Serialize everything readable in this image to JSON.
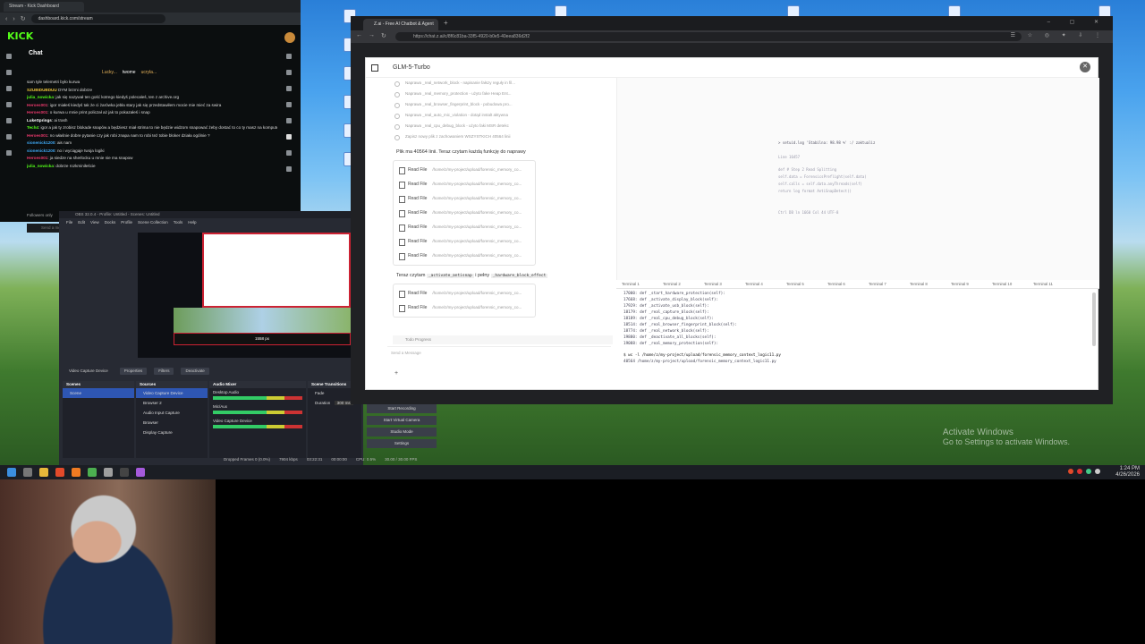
{
  "taskbar": {
    "time": "1:24 PM",
    "date": "4/26/2026"
  },
  "watermark": {
    "line1": "Activate Windows",
    "line2": "Go to Settings to activate Windows."
  },
  "kick": {
    "tab_title": "Stream - Kick Dashboard",
    "url": "dashboard.kick.com/stream",
    "logo": "KICK",
    "chat_title": "Chat",
    "pinned": [
      "Lucky...",
      "twome",
      "ucryla..."
    ],
    "messages": [
      {
        "user": "",
        "text": "sam tyle telemetri było kurwa",
        "color": "#ffffff"
      },
      {
        "user": "SZUBIDUBDUU",
        "text": " DYM brzmi dobrze",
        "color": "#e8c13a"
      },
      {
        "user": "julia_nowicka",
        "text": ": jak się nazywał ten gość kotrego kiedyś polecałeś, ten z archive.org",
        "color": "#53fc18"
      },
      {
        "user": "Heroes001",
        "text": ": igor miałeś kiedyś tak że ci żarówka jebła stary jak się przedstawiłem mocie mie mieć za swira",
        "color": "#e5386a"
      },
      {
        "user": "Heroes001",
        "text": ": o kurwa u mnie print policzał aż jak to pokazałeś i snap",
        "color": "#e5386a"
      },
      {
        "user": "LukeSprings",
        "text": ": ai trash",
        "color": "#ffffff"
      },
      {
        "user": "Tech4",
        "text": ": igor a jak ty zrobisz blokade snapów a będziesz miał strima to nie będzie widzom snapować żeby dostać to co ty masz na komputerze",
        "color": "#53fc18"
      },
      {
        "user": "Heroes001",
        "text": ": no właśnie dobre pytanie czy jak robi znapa nam to robi też tobie bloker działa ogólnie ?",
        "color": "#e5386a"
      },
      {
        "user": "sionenick1200",
        "text": ": ais nam",
        "color": "#3fa9f5"
      },
      {
        "user": "sionenick1200",
        "text": ": no i wyciągaje twoja logiki",
        "color": "#3fa9f5"
      },
      {
        "user": "Heroes001",
        "text": ": ja siedze na sherlocku u mnie nie ma snapow",
        "color": "#e5386a"
      },
      {
        "user": "julia_nowicka",
        "text": ": dobrze rozkminiłeście",
        "color": "#53fc18"
      }
    ],
    "followers_only": "Followers only",
    "send_placeholder": "Send a message"
  },
  "obs": {
    "title": "OBS 32.0.4 - Profile: Untitled - Scenes: Untitled",
    "menu": [
      "File",
      "Edit",
      "View",
      "Docks",
      "Profile",
      "Scene Collection",
      "Tools",
      "Help"
    ],
    "preview_text": "1558 px",
    "source_toolbar": [
      "Video Capture Device",
      "Properties",
      "Filters",
      "Deactivate"
    ],
    "scenes_title": "Scenes",
    "scenes": [
      "Scene"
    ],
    "sources_title": "Sources",
    "sources": [
      "Video Capture Device",
      "Browser 2",
      "Audio Input Capture",
      "Browser",
      "Display Capture"
    ],
    "mixer_title": "Audio Mixer",
    "mixer": [
      "Desktop Audio",
      "Mic/Aux",
      "Video Capture Device"
    ],
    "transitions_title": "Scene Transitions",
    "transition": "Fade",
    "duration_label": "Duration",
    "duration": "300 ms",
    "controls": [
      "Start Recording",
      "Start Virtual Camera",
      "Studio Mode",
      "Settings"
    ],
    "status": [
      "Dropped Frames 0 (0.0%)",
      "7904 kbps",
      "03:22:31",
      "00:00:00",
      "CPU: 0.5%",
      "30.00 / 30.00 FPS"
    ]
  },
  "zai": {
    "tab_title": "Z.ai - Free AI Chatbot & Agent",
    "url": "https://chat.z.ai/c/8f6c81ba-33f5-4920-b0e5-40eea836d2f2",
    "model": "GLM-5-Turbo",
    "fixes": [
      "Naprawa _real_network_block - napisanie fałszy reguły in fil...",
      "Naprawa _real_memory_protection - użyto fake Heap Ent...",
      "Naprawa _real_browser_fingerprint_block - pobudowa pro...",
      "Naprawa _real_auto_mic_violation - dotąd instalt aktywna",
      "Naprawa _real_cpu_debug_block - użyto faki MSR detekc",
      "Zapisz nowy plik z zachowaniem WSZYSTKICH 40564 linii"
    ],
    "plik_text": "Plik ma 40564 linii. Teraz czytam każdą funkcję do naprawy",
    "read_label": "Read File",
    "read_path": "/home/z/my-project/upload/forensic_memory_co...",
    "read_count_1": 7,
    "teraz_prefix": "Teraz czytam",
    "teraz_code1": "_activate_antisnap",
    "teraz_mid": "i pełny",
    "teraz_code2": "_hardware_block_effect",
    "read_count_2": 2,
    "todo": "Todo Progress",
    "message_placeholder": "Send a Message",
    "editor_lines": [
      "> setuid.log  'Stabilna: 98.98 %'  :/ zaktualiz",
      "Line 16457",
      "def   # Step 2  Read Splitting",
      "   self.data = ForensicsPreflight(self.data)",
      "   self.calls = self.data.anyThreads(self)",
      "   return log  format  AntiSnapDetect()",
      "Ctrl  DB    ln 1660    Col 44    UTF-8"
    ],
    "terminal_tabs": [
      "Terminal 1",
      "Terminal 2",
      "Terminal 3",
      "Terminal 4",
      "Terminal 5",
      "Terminal 6",
      "Terminal 7",
      "Terminal 8",
      "Terminal 9",
      "Terminal 10",
      "Terminal 11"
    ],
    "terminal_lines": [
      "17000:     def _start_hardware_protection(self):",
      "17668:     def _activate_display_block(self):",
      "17929:     def _activate_usb_block(self):",
      "18179:     def _real_capture_block(self):",
      "18189:     def _real_cpu_debug_block(self):",
      "18514:     def _real_browser_fingerprint_block(self):",
      "18774:     def _real_network_block(self):",
      "19880:     def _deactivate_all_blocks(self):",
      "19088:     def _real_memory_protection(self):"
    ],
    "terminal_cmd": "$ wc -l /home/z/my-project/upload/forensic_memory_context_logic11.py",
    "terminal_out": "40564 /home/z/my-project/upload/forensic_memory_context_logic11.py"
  }
}
